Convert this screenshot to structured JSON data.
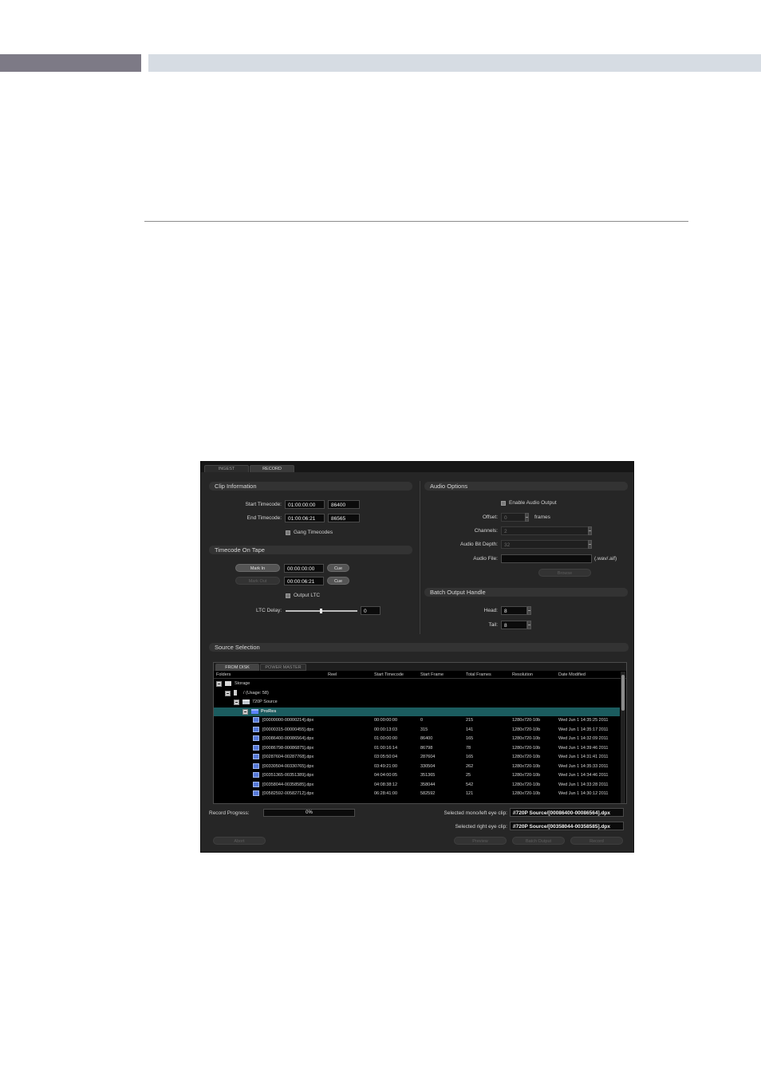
{
  "tabs": [
    {
      "label": "INGEST",
      "active": false
    },
    {
      "label": "RECORD",
      "active": true
    }
  ],
  "clip_info": {
    "title": "Clip Information",
    "start_label": "Start Timecode:",
    "start_tc": "01:00:00:00",
    "start_frame": "86400",
    "end_label": "End Timecode:",
    "end_tc": "01:00:06:21",
    "end_frame": "86565",
    "gang_label": "Gang Timecodes"
  },
  "tc_on_tape": {
    "title": "Timecode On Tape",
    "mark_in": "Mark In",
    "mark_in_tc": "00:00:00:00",
    "cue": "Cue",
    "mark_out": "Mark Out",
    "mark_out_tc": "00:00:06:21",
    "output_ltc": "Output LTC",
    "ltc_delay_label": "LTC Delay:",
    "ltc_delay_value": "0"
  },
  "audio": {
    "title": "Audio Options",
    "enable_label": "Enable Audio Output",
    "offset_label": "Offset:",
    "offset_value": "0",
    "offset_unit": "frames",
    "channels_label": "Channels:",
    "channels_value": "2",
    "bitdepth_label": "Audio Bit Depth:",
    "bitdepth_value": "32",
    "file_label": "Audio File:",
    "file_value": "",
    "file_ext": "(.wav/.aif)",
    "browse": "Browse"
  },
  "batch": {
    "title": "Batch Output Handle",
    "head_label": "Head:",
    "head_value": "8",
    "tail_label": "Tail:",
    "tail_value": "8"
  },
  "source": {
    "title": "Source Selection",
    "tabs": [
      {
        "label": "FROM DISK",
        "active": true
      },
      {
        "label": "POWER MASTER",
        "active": false
      }
    ],
    "columns": [
      "Folders",
      "Reel",
      "Start Timecode",
      "Start Frame",
      "Total Frames",
      "Resolution",
      "Date Modified"
    ],
    "tree": [
      {
        "name": "Storage",
        "level": 0,
        "icon": "drive"
      },
      {
        "name": "/ (Usage: 58)",
        "level": 1,
        "icon": "disk"
      },
      {
        "name": "720P Source",
        "level": 2,
        "icon": "folder"
      },
      {
        "name": "ProRes",
        "level": 3,
        "icon": "folder-blue",
        "selected": true
      }
    ],
    "files": [
      {
        "name": "[00000000-00000214].dpx",
        "tc": "00:00:00:00",
        "start": "0",
        "total": "215",
        "res": "1280x720-10b",
        "date": "Wed Jun  1 14:35:25 2011"
      },
      {
        "name": "[00000315-00000455].dpx",
        "tc": "00:00:13:03",
        "start": "315",
        "total": "141",
        "res": "1280x720-10b",
        "date": "Wed Jun  1 14:35:17 2011"
      },
      {
        "name": "[00086400-00086564].dpx",
        "tc": "01:00:00:00",
        "start": "86400",
        "total": "165",
        "res": "1280x720-10b",
        "date": "Wed Jun  1 14:32:09 2011"
      },
      {
        "name": "[00086798-00086875].dpx",
        "tc": "01:00:16:14",
        "start": "86798",
        "total": "78",
        "res": "1280x720-10b",
        "date": "Wed Jun  1 14:39:46 2011"
      },
      {
        "name": "[00287604-00287768].dpx",
        "tc": "03:05:50:04",
        "start": "287604",
        "total": "165",
        "res": "1280x720-10b",
        "date": "Wed Jun  1 14:31:41 2011"
      },
      {
        "name": "[00330504-00330765].dpx",
        "tc": "03:49:21:00",
        "start": "330504",
        "total": "262",
        "res": "1280x720-10b",
        "date": "Wed Jun  1 14:35:33 2011"
      },
      {
        "name": "[00351365-00351389].dpx",
        "tc": "04:04:00:05",
        "start": "351365",
        "total": "25",
        "res": "1280x720-10b",
        "date": "Wed Jun  1 14:34:46 2011"
      },
      {
        "name": "[00358044-00358585].dpx",
        "tc": "04:08:38:12",
        "start": "358044",
        "total": "542",
        "res": "1280x720-10b",
        "date": "Wed Jun  1 14:33:28 2011"
      },
      {
        "name": "[00582592-00582712].dpx",
        "tc": "06:28:41:00",
        "start": "582592",
        "total": "121",
        "res": "1280x720-10b",
        "date": "Wed Jun  1 14:30:12 2011"
      }
    ]
  },
  "footer": {
    "progress_label": "Record Progress:",
    "progress_value": "0%",
    "mono_label": "Selected mono/left eye clip:",
    "mono_value": "//720P Source/[00086400-00086564].dpx",
    "right_label": "Selected right eye clip:",
    "right_value": "//720P Source/[00358044-00358585].dpx",
    "abort": "Abort",
    "preview": "Preview",
    "batch_output": "Batch Output",
    "record": "Record"
  },
  "colors": {
    "panel_bg": "#262626",
    "selection": "#1b5c5f",
    "header_bar_left": "#7d7a86",
    "header_bar_right": "#d6dce3"
  }
}
